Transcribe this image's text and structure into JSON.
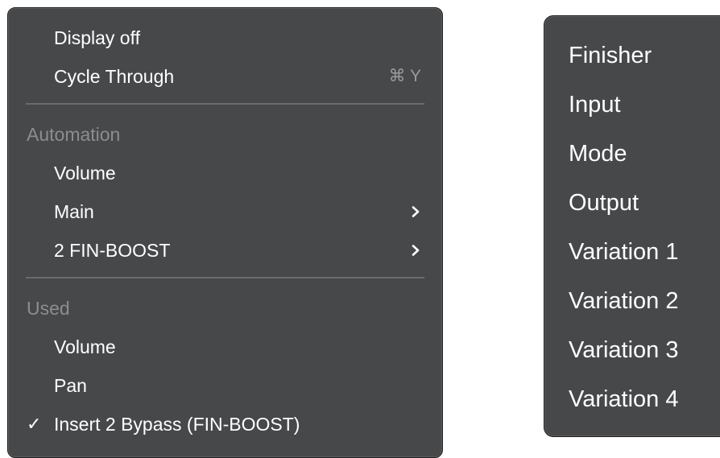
{
  "left_menu": {
    "items": [
      {
        "label": "Display off"
      },
      {
        "label": "Cycle Through",
        "shortcut": "⌘ Y"
      }
    ],
    "automation": {
      "header": "Automation",
      "items": [
        {
          "label": "Volume"
        },
        {
          "label": "Main",
          "has_submenu": true
        },
        {
          "label": "2 FIN-BOOST",
          "has_submenu": true
        }
      ]
    },
    "used": {
      "header": "Used",
      "items": [
        {
          "label": "Volume"
        },
        {
          "label": "Pan"
        },
        {
          "label": "Insert 2 Bypass (FIN-BOOST)",
          "checked": true,
          "check_glyph": "✓"
        }
      ]
    }
  },
  "right_menu": {
    "items": [
      {
        "label": "Finisher"
      },
      {
        "label": "Input"
      },
      {
        "label": "Mode"
      },
      {
        "label": "Output"
      },
      {
        "label": "Variation 1"
      },
      {
        "label": "Variation 2"
      },
      {
        "label": "Variation 3"
      },
      {
        "label": "Variation 4"
      }
    ]
  },
  "colors": {
    "menu_background": "#474849",
    "text": "#ffffff",
    "header_text": "#8c8d8e",
    "separator": "#6a6b6c"
  },
  "icons": {
    "submenu": "chevron-right-icon",
    "checkmark": "checkmark-icon",
    "command_key": "command-key-icon"
  }
}
